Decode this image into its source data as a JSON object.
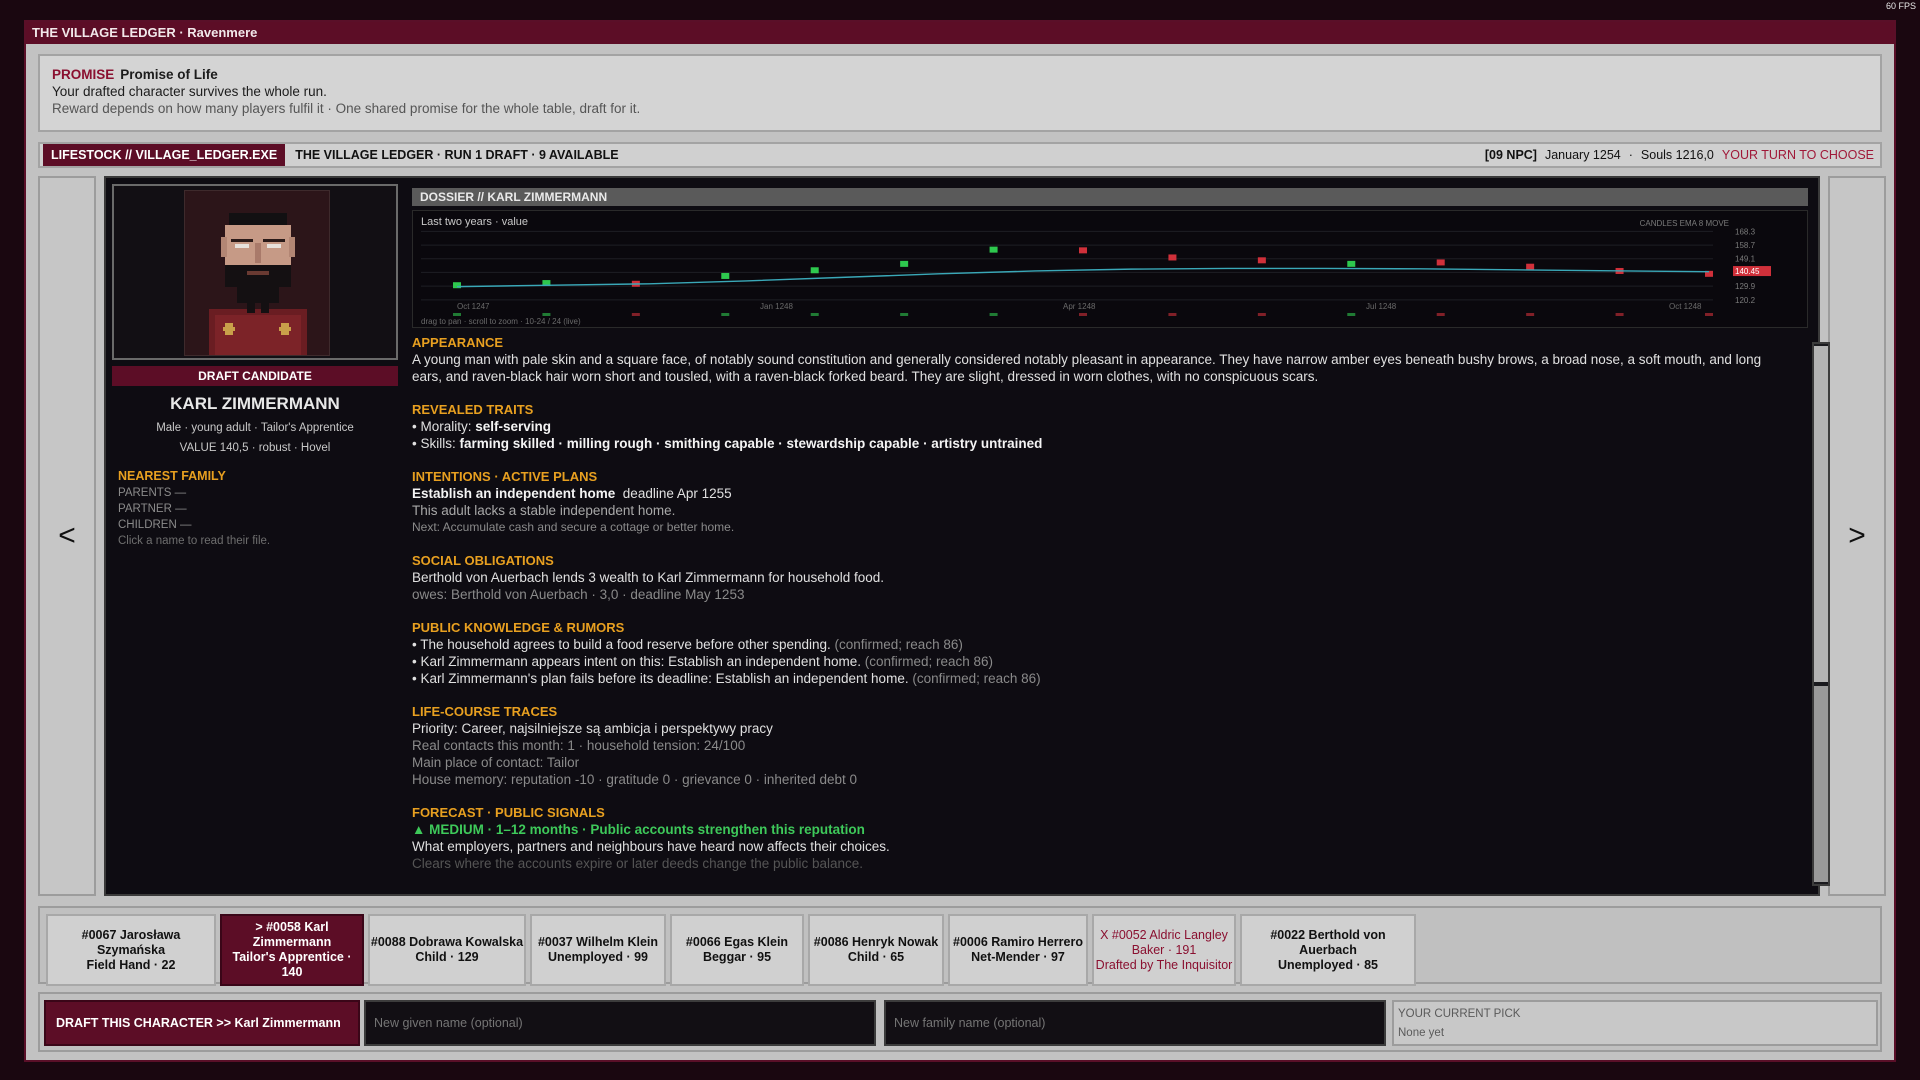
{
  "fps": "60 FPS",
  "window_title": "THE VILLAGE LEDGER · Ravenmere",
  "promise": {
    "tag": "PROMISE",
    "title": "Promise of Life",
    "text": "Your drafted character survives the whole run.",
    "note": "Reward depends on how many players fulfil it · One shared promise for the whole table, draft for it."
  },
  "status": {
    "exe": "LIFESTOCK // VILLAGE_LEDGER.EXE",
    "run": "THE VILLAGE LEDGER · RUN 1 DRAFT · 9 AVAILABLE",
    "npc": "[09 NPC]",
    "date": "January 1254",
    "souls": "Souls 1216,0",
    "turn": "YOUR TURN TO CHOOSE"
  },
  "nav": {
    "prev": "<",
    "next": ">"
  },
  "candidate": {
    "badge": "DRAFT CANDIDATE",
    "name": "KARL ZIMMERMANN",
    "subtitle": "Male · young adult · Tailor's Apprentice",
    "value_line": "VALUE 140,5 · robust · Hovel",
    "family_heading": "NEAREST FAMILY",
    "parents": "PARENTS —",
    "partner": "PARTNER —",
    "children": "CHILDREN —",
    "hint": "Click a name to read their file."
  },
  "dossier": {
    "header": "DOSSIER // KARL ZIMMERMANN",
    "chart_label": "Last two years · value",
    "chart_modes": "CANDLES  EMA 8  MOVE",
    "chart_footer": "drag to pan · scroll to zoom · 10-24 / 24 (live)"
  },
  "chart_data": {
    "type": "line",
    "title": "Last two years · value",
    "x_ticks": [
      "Oct 1247",
      "Jan 1248",
      "Apr 1248",
      "Jul 1248",
      "Oct 1248"
    ],
    "y_ticks": [
      168.3,
      158.7,
      149.1,
      139.5,
      129.9,
      120.2
    ],
    "current_value_label": "140.45",
    "series": [
      {
        "name": "EMA 8",
        "values": [
          129.5,
          130.5,
          131.5,
          133.5,
          136,
          138.5,
          140.5,
          141.8,
          142.3,
          142.3,
          142.0,
          141.3,
          140.6,
          140.0
        ]
      }
    ],
    "candles": [
      {
        "value": 130.5,
        "dir": "up"
      },
      {
        "value": 132.0,
        "dir": "up"
      },
      {
        "value": 131.5,
        "dir": "down"
      },
      {
        "value": 137.0,
        "dir": "up"
      },
      {
        "value": 141.0,
        "dir": "up"
      },
      {
        "value": 145.5,
        "dir": "up"
      },
      {
        "value": 155.5,
        "dir": "up"
      },
      {
        "value": 155.0,
        "dir": "down"
      },
      {
        "value": 150.0,
        "dir": "down"
      },
      {
        "value": 148.0,
        "dir": "down"
      },
      {
        "value": 145.5,
        "dir": "up"
      },
      {
        "value": 146.5,
        "dir": "down"
      },
      {
        "value": 143.5,
        "dir": "down"
      },
      {
        "value": 140.5,
        "dir": "down"
      },
      {
        "value": 138.5,
        "dir": "down"
      }
    ],
    "ylim": [
      118,
      170
    ],
    "colors": {
      "up": "#2ec84e",
      "down": "#d0303a",
      "ema": "#3aa8b8",
      "current": "#d0303a"
    }
  },
  "sections": {
    "appearance": {
      "heading": "APPEARANCE",
      "text": "A young man with pale skin and a square face, of notably sound constitution and generally considered notably pleasant in appearance. They have narrow amber eyes beneath bushy brows, a broad nose, a soft mouth, and long ears, and raven-black hair worn short and tousled, with a raven-black forked beard. They are slight, dressed in worn clothes, with no conspicuous scars."
    },
    "traits": {
      "heading": "REVEALED TRAITS",
      "morality_label": "• Morality: ",
      "morality": "self-serving",
      "skills_label": "• Skills: ",
      "skills": "farming skilled · milling rough · smithing capable · stewardship capable · artistry untrained"
    },
    "intentions": {
      "heading": "INTENTIONS · ACTIVE PLANS",
      "plan": "Establish an independent home",
      "deadline": "deadline Apr 1255",
      "reason": "This adult lacks a stable independent home.",
      "next": "Next: Accumulate cash and secure a cottage or better home."
    },
    "obligations": {
      "heading": "SOCIAL OBLIGATIONS",
      "text": "Berthold von Auerbach lends 3 wealth to Karl Zimmermann for household food.",
      "owes": "owes: Berthold von Auerbach · 3,0 · deadline May 1253"
    },
    "rumors": {
      "heading": "PUBLIC KNOWLEDGE & RUMORS",
      "items": [
        {
          "text": "• The household agrees to build a food reserve before other spending.",
          "note": "(confirmed; reach 86)"
        },
        {
          "text": "• Karl Zimmermann appears intent on this: Establish an independent home.",
          "note": "(confirmed; reach 86)"
        },
        {
          "text": "• Karl Zimmermann's plan fails before its deadline: Establish an independent home.",
          "note": "(confirmed; reach 86)"
        }
      ]
    },
    "lifecourse": {
      "heading": "LIFE-COURSE TRACES",
      "priority": "Priority: Career, najsilniejsze są ambicja i perspektywy pracy",
      "contacts": "Real contacts this month: 1 · household tension: 24/100",
      "place": "Main place of contact: Tailor",
      "memory": "House memory: reputation -10 · gratitude 0 · grievance 0 · inherited debt 0"
    },
    "forecast": {
      "heading": "FORECAST · PUBLIC SIGNALS",
      "signal": "▲ MEDIUM · 1–12 months · Public accounts strengthen this reputation",
      "text": "What employers, partners and neighbours have heard now affects their choices.",
      "cut": "Clears where the accounts expire or later deeds change the public balance."
    }
  },
  "cards": [
    {
      "line1": "#0067  Jarosława Szymańska",
      "line2": "Field Hand · 22",
      "line3": "",
      "state": "normal"
    },
    {
      "line1": "> #0058  Karl Zimmermann",
      "line2": "Tailor's Apprentice · 140",
      "line3": "",
      "state": "selected"
    },
    {
      "line1": "#0088  Dobrawa Kowalska",
      "line2": "Child · 129",
      "line3": "",
      "state": "normal"
    },
    {
      "line1": "#0037  Wilhelm Klein",
      "line2": "Unemployed · 99",
      "line3": "",
      "state": "normal"
    },
    {
      "line1": "#0066  Egas Klein",
      "line2": "Beggar · 95",
      "line3": "",
      "state": "normal"
    },
    {
      "line1": "#0086  Henryk Nowak",
      "line2": "Child · 65",
      "line3": "",
      "state": "normal"
    },
    {
      "line1": "#0006  Ramiro Herrero",
      "line2": "Net-Mender · 97",
      "line3": "",
      "state": "normal"
    },
    {
      "line1": "X #0052  Aldric Langley",
      "line2": "Baker · 191",
      "line3": "Drafted by The Inquisitor",
      "state": "taken"
    },
    {
      "line1": "#0022  Berthold von Auerbach",
      "line2": "Unemployed · 85",
      "line3": "",
      "state": "normal"
    }
  ],
  "draft": {
    "button": "DRAFT THIS CHARACTER  >>  Karl Zimmermann",
    "given_placeholder": "New given name (optional)",
    "family_placeholder": "New family name (optional)",
    "pick_label": "YOUR CURRENT PICK",
    "pick_value": "None yet"
  }
}
